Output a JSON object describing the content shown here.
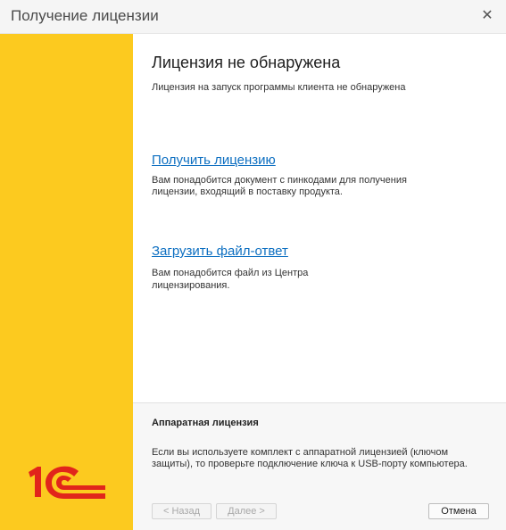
{
  "window": {
    "title": "Получение лицензии",
    "close_icon": "close-icon"
  },
  "main": {
    "heading": "Лицензия не обнаружена",
    "subtext": "Лицензия на запуск программы клиента не обнаружена",
    "get_license": {
      "link": "Получить лицензию",
      "description_line1": "Вам понадобится документ с пинкодами для получения",
      "description_line2": "лицензии, входящий в поставку продукта."
    },
    "upload_response": {
      "link": "Загрузить файл-ответ",
      "description_line1": "Вам понадобится файл из Центра",
      "description_line2": "лицензирования."
    }
  },
  "hardware": {
    "title": "Аппаратная лицензия",
    "text_line1": "Если вы используете комплект с аппаратной лицензией (ключом",
    "text_line2": "защиты), то проверьте подключение ключа к USB-порту компьютера."
  },
  "buttons": {
    "back": "< Назад",
    "next": "Далее >",
    "cancel": "Отмена"
  },
  "logo": {
    "text": "1С",
    "color": "#e1251b"
  },
  "colors": {
    "side_panel": "#fcca1f",
    "link": "#0d6fc1"
  }
}
